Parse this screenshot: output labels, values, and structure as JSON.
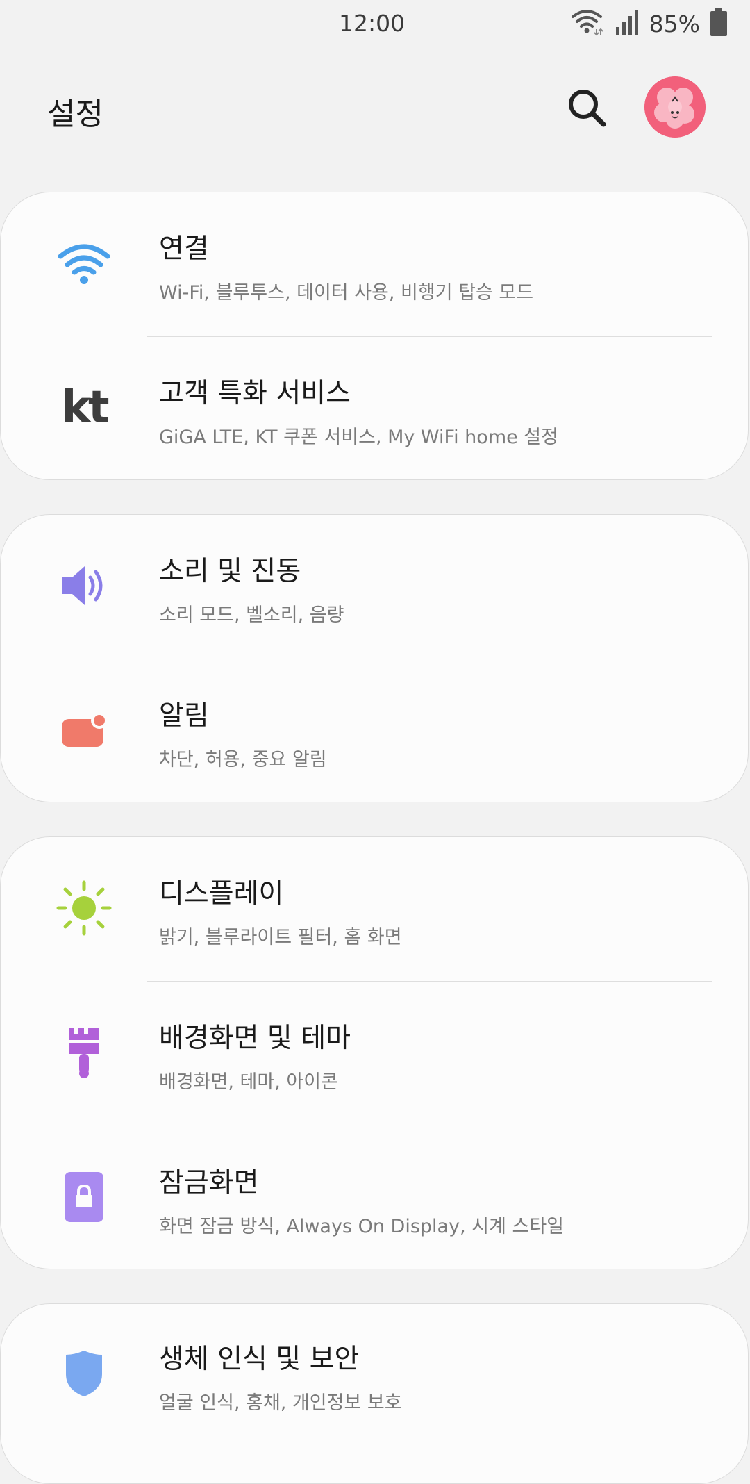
{
  "status": {
    "time": "12:00",
    "battery_percent": "85%"
  },
  "header": {
    "title": "설정"
  },
  "cards": [
    {
      "items": [
        {
          "title": "연결",
          "subtitle": "Wi-Fi, 블루투스, 데이터 사용, 비행기 탑승 모드",
          "icon": "wifi-icon",
          "color": "#4aa0ea"
        },
        {
          "title": "고객 특화 서비스",
          "subtitle": "GiGA LTE, KT 쿠폰 서비스, My WiFi home 설정",
          "icon": "kt-logo-icon",
          "icon_text": "kt",
          "color": "#3d3d3d"
        }
      ]
    },
    {
      "items": [
        {
          "title": "소리 및 진동",
          "subtitle": "소리 모드, 벨소리, 음량",
          "icon": "speaker-icon",
          "color": "#8a7ee8"
        },
        {
          "title": "알림",
          "subtitle": "차단, 허용, 중요 알림",
          "icon": "notification-icon",
          "color": "#f07a6a"
        }
      ]
    },
    {
      "items": [
        {
          "title": "디스플레이",
          "subtitle": "밝기, 블루라이트 필터, 홈 화면",
          "icon": "sun-icon",
          "color": "#a6d13c"
        },
        {
          "title": "배경화면 및 테마",
          "subtitle": "배경화면, 테마, 아이콘",
          "icon": "paintbrush-icon",
          "color": "#b160d9"
        },
        {
          "title": "잠금화면",
          "subtitle": "화면 잠금 방식, Always On Display, 시계 스타일",
          "icon": "lock-icon",
          "color": "#a98af0"
        }
      ]
    },
    {
      "items": [
        {
          "title": "생체 인식 및 보안",
          "subtitle": "얼굴 인식, 홍채, 개인정보 보호",
          "icon": "shield-icon",
          "color": "#7aa8f0"
        }
      ]
    }
  ]
}
